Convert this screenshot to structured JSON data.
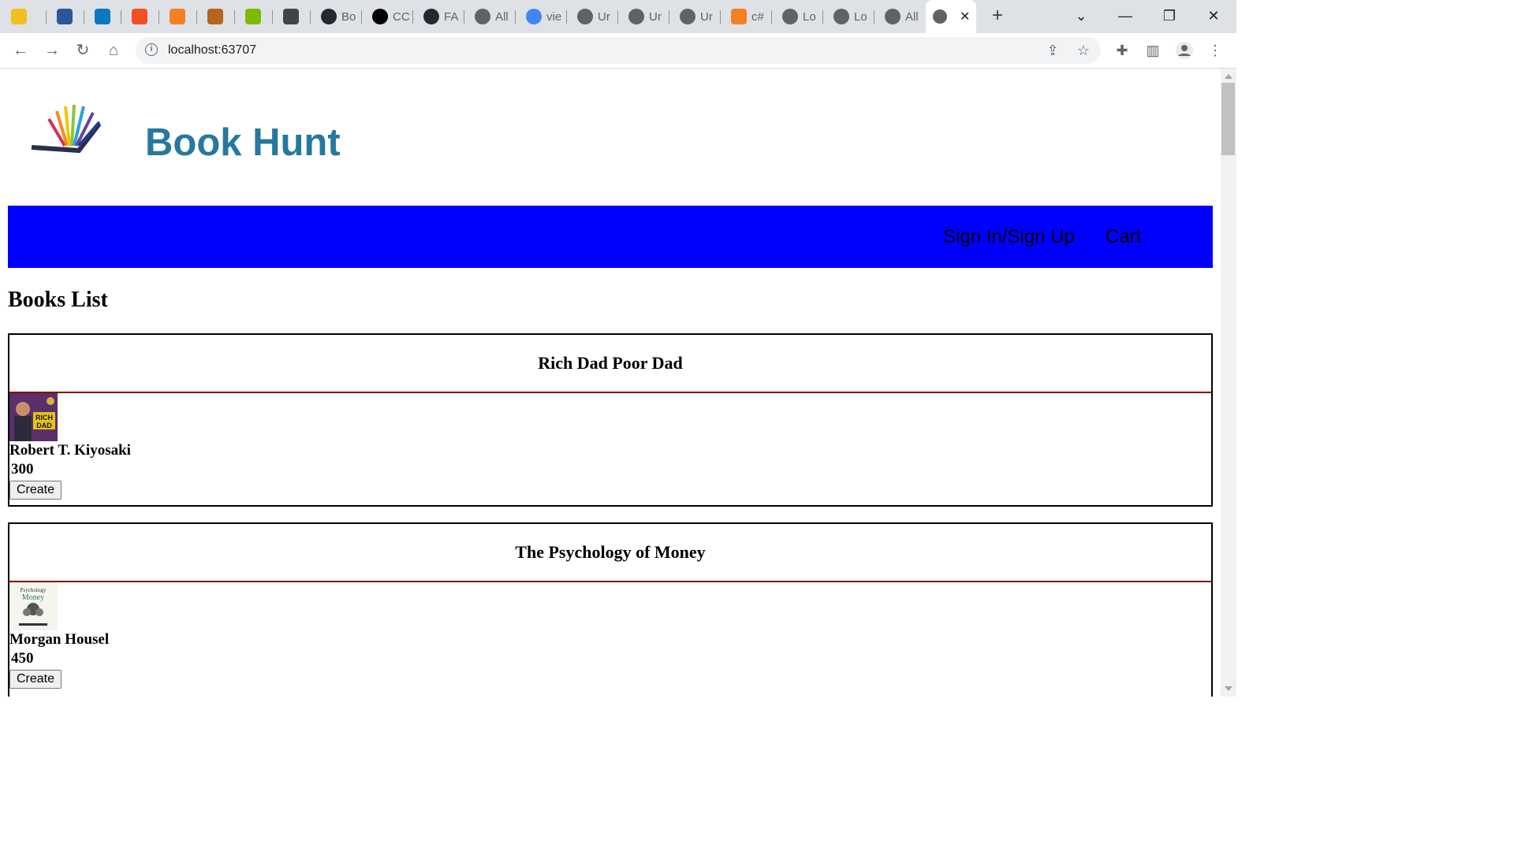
{
  "browser": {
    "tabs": [
      {
        "label": "",
        "icon": "folder-icon",
        "color": "#f2c01e"
      },
      {
        "label": "",
        "icon": "word-icon",
        "color": "#2b579a"
      },
      {
        "label": "",
        "icon": "video-icon",
        "color": "#0a77c2"
      },
      {
        "label": "",
        "icon": "microsoft-icon",
        "color": "#f25022"
      },
      {
        "label": "",
        "icon": "stackoverflow-icon",
        "color": "#f48024"
      },
      {
        "label": "",
        "icon": "app-icon",
        "color": "#b5651d"
      },
      {
        "label": "",
        "icon": "microsoft-icon",
        "color": "#7fba00"
      },
      {
        "label": "",
        "icon": "arc-icon",
        "color": "#444444"
      },
      {
        "label": "Bo",
        "icon": "github-icon",
        "color": "#24292f"
      },
      {
        "label": "CC",
        "icon": "amazon-icon",
        "color": "#000000"
      },
      {
        "label": "FA",
        "icon": "github-icon",
        "color": "#24292f"
      },
      {
        "label": "All",
        "icon": "globe-icon",
        "color": "#5f6368"
      },
      {
        "label": "vie",
        "icon": "google-icon",
        "color": "#4285f4"
      },
      {
        "label": "Ur",
        "icon": "globe-icon",
        "color": "#5f6368"
      },
      {
        "label": "Ur",
        "icon": "globe-icon",
        "color": "#5f6368"
      },
      {
        "label": "Ur",
        "icon": "globe-icon",
        "color": "#5f6368"
      },
      {
        "label": "c#",
        "icon": "stackoverflow-icon",
        "color": "#f48024"
      },
      {
        "label": "Lo",
        "icon": "globe-icon",
        "color": "#5f6368"
      },
      {
        "label": "Lo",
        "icon": "globe-icon",
        "color": "#5f6368"
      },
      {
        "label": "All",
        "icon": "globe-icon",
        "color": "#5f6368"
      }
    ],
    "active_tab_close": "✕",
    "new_tab": "+",
    "url": "localhost:63707"
  },
  "site": {
    "title": "Book Hunt",
    "nav": {
      "signin": "Sign In/Sign Up",
      "cart": "Cart"
    },
    "nav_color": "#0000ff",
    "title_color": "#26789d"
  },
  "books_section": {
    "title": "Books List",
    "books": [
      {
        "title": "Rich Dad Poor Dad",
        "author": "Robert T. Kiyosaki",
        "price": "300",
        "button": "Create",
        "cover_text": "RICH DAD"
      },
      {
        "title": "The Psychology of Money",
        "author": "Morgan Housel",
        "price": "450",
        "button": "Create",
        "cover_text": "Psychology Money"
      }
    ]
  }
}
